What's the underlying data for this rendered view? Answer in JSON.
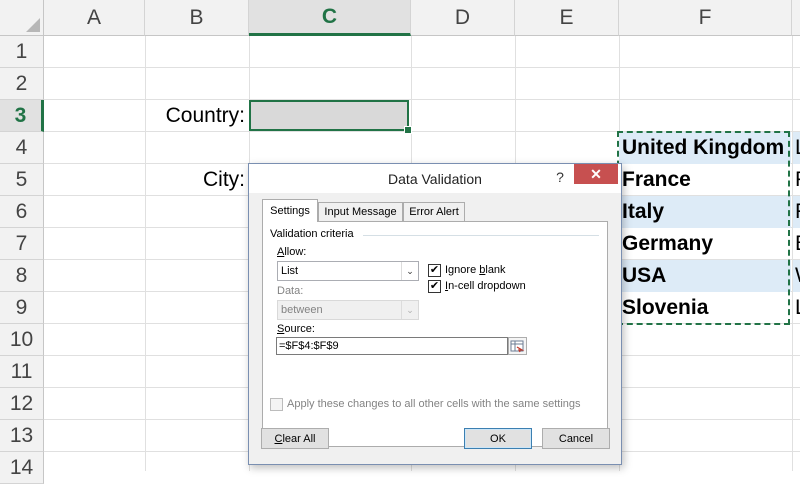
{
  "columns": [
    "A",
    "B",
    "C",
    "D",
    "E",
    "F"
  ],
  "rows": [
    "1",
    "2",
    "3",
    "4",
    "5",
    "6",
    "7",
    "8",
    "9",
    "10",
    "11",
    "12",
    "13",
    "14"
  ],
  "labels": {
    "country": "Country:",
    "city": "City:"
  },
  "country_list": [
    "United Kingdom",
    "France",
    "Italy",
    "Germany",
    "USA",
    "Slovenia"
  ],
  "next_column_glyphs": [
    "L",
    "P",
    "R",
    "B",
    "W",
    "L"
  ],
  "dialog": {
    "title": "Data Validation",
    "help": "?",
    "close": "✕",
    "tabs": [
      "Settings",
      "Input Message",
      "Error Alert"
    ],
    "active_tab": "Settings",
    "group_label": "Validation criteria",
    "allow_label_pre": "",
    "allow_label_u": "A",
    "allow_label_post": "llow:",
    "allow_value": "List",
    "data_label": "Data:",
    "data_value": "between",
    "ignore_blank_pre": "Ignore ",
    "ignore_blank_u": "b",
    "ignore_blank_post": "lank",
    "incell_pre": "",
    "incell_u": "I",
    "incell_post": "n-cell dropdown",
    "source_label_pre": "",
    "source_label_u": "S",
    "source_label_post": "ource:",
    "source_value": "=$F$4:$F$9",
    "apply_all": "Apply these changes to all other cells with the same settings",
    "clear_all_u": "C",
    "clear_all_post": "lear All",
    "ok": "OK",
    "cancel": "Cancel"
  },
  "colors": {
    "accent": "#217346",
    "band": "#ddebf7",
    "close": "#c75050"
  }
}
